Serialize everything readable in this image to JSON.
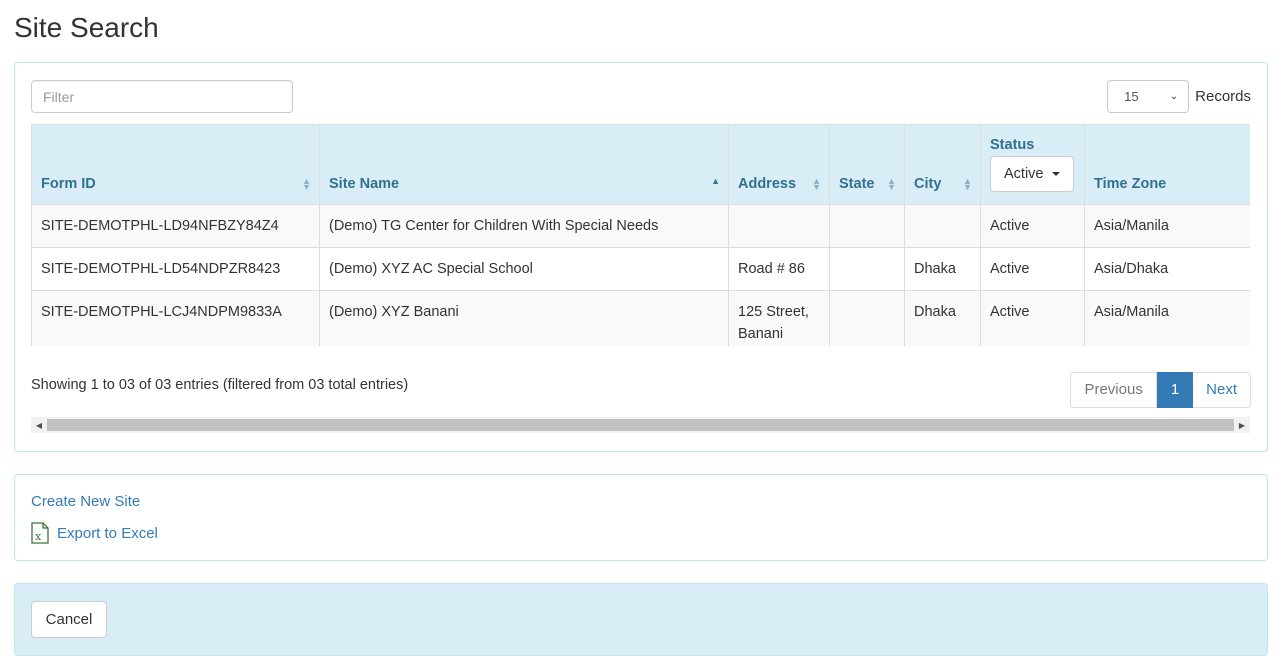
{
  "page": {
    "title": "Site Search"
  },
  "search": {
    "filter_placeholder": "Filter",
    "filter_value": "",
    "records_value": "15",
    "records_label": "Records"
  },
  "table": {
    "columns": [
      {
        "label": "Form ID",
        "sort": "both"
      },
      {
        "label": "Site Name",
        "sort": "asc"
      },
      {
        "label": "Address",
        "sort": "both"
      },
      {
        "label": "State",
        "sort": "both"
      },
      {
        "label": "City",
        "sort": "both"
      },
      {
        "label": "Status",
        "filter_value": "Active"
      },
      {
        "label": "Time Zone"
      }
    ],
    "rows": [
      {
        "form_id": "SITE-DEMOTPHL-LD94NFBZY84Z4",
        "site_name": "(Demo) TG Center for Children With Special Needs",
        "address": "",
        "state": "",
        "city": "",
        "status": "Active",
        "time_zone": "Asia/Manila"
      },
      {
        "form_id": "SITE-DEMOTPHL-LD54NDPZR8423",
        "site_name": "(Demo) XYZ AC Special School",
        "address": "Road # 86",
        "state": "",
        "city": "Dhaka",
        "status": "Active",
        "time_zone": "Asia/Dhaka"
      },
      {
        "form_id": "SITE-DEMOTPHL-LCJ4NDPM9833A",
        "site_name": "(Demo) XYZ Banani",
        "address": "125 Street, Banani",
        "state": "",
        "city": "Dhaka",
        "status": "Active",
        "time_zone": "Asia/Manila"
      }
    ]
  },
  "info": {
    "text": "Showing 1 to 03 of 03 entries (filtered from 03 total entries)"
  },
  "pagination": {
    "previous": "Previous",
    "current": "1",
    "next": "Next"
  },
  "actions": {
    "create_label": "Create New Site",
    "export_label": "Export to Excel"
  },
  "footer": {
    "cancel_label": "Cancel"
  },
  "colors": {
    "accent": "#337ab7",
    "header_bg": "#d9edf7",
    "header_text": "#31708f",
    "panel_border": "#bce8f1"
  }
}
